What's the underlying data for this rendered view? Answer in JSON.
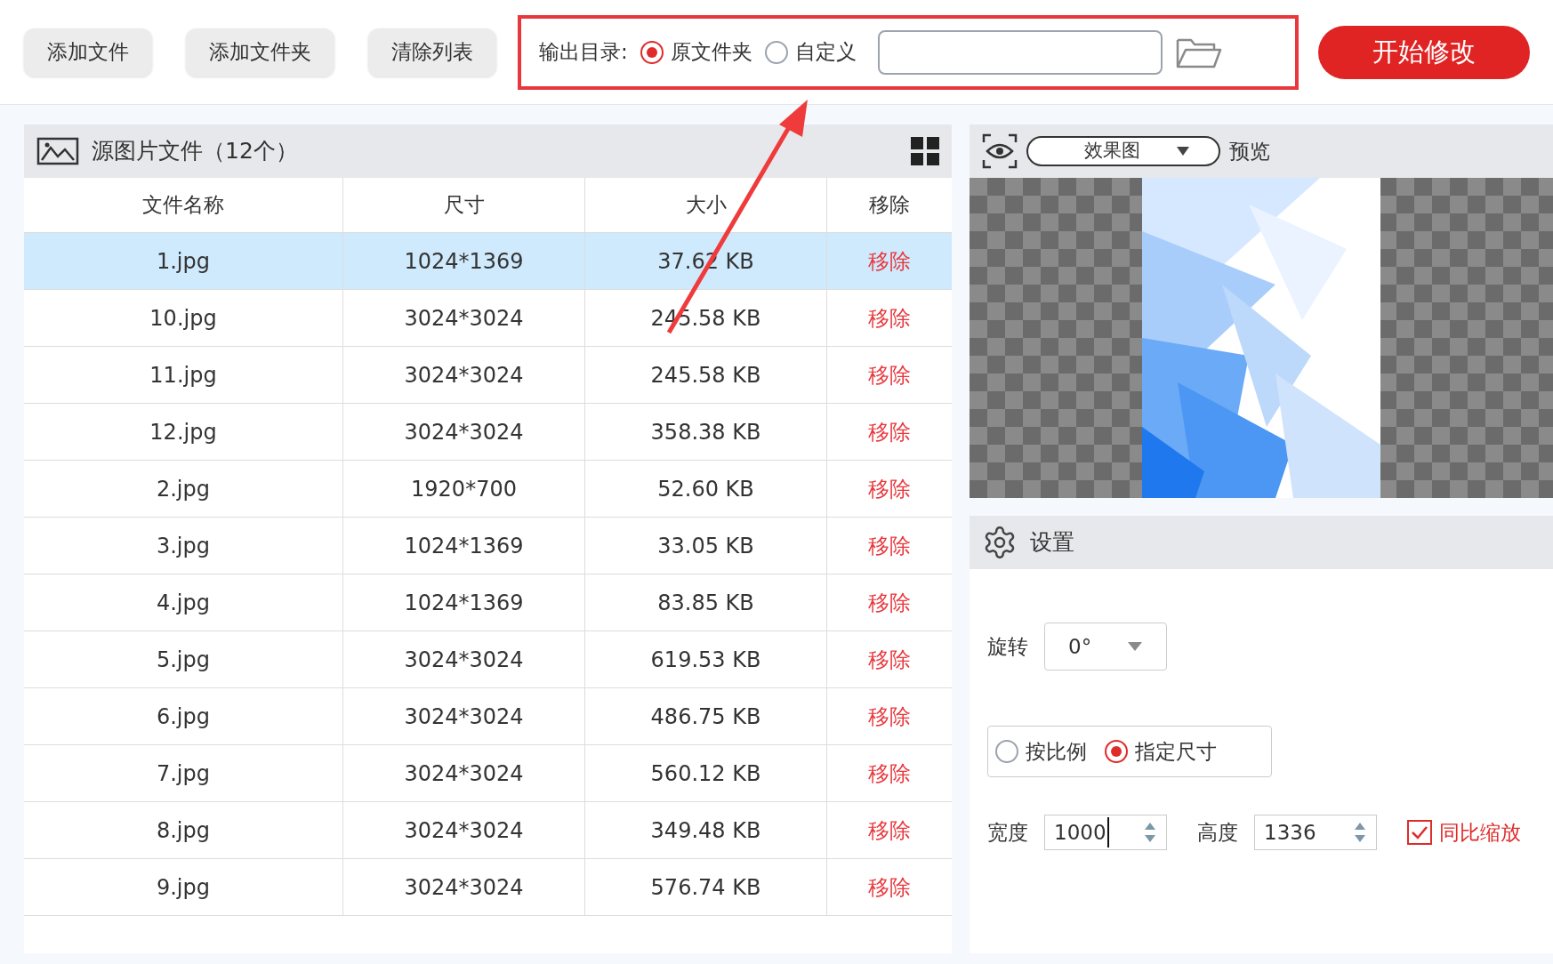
{
  "toolbar": {
    "buttons": [
      "添加文件",
      "添加文件夹",
      "清除列表"
    ],
    "output": {
      "label": "输出目录:",
      "options": [
        {
          "label": "原文件夹",
          "selected": true
        },
        {
          "label": "自定义",
          "selected": false
        }
      ]
    },
    "start_button": "开始修改"
  },
  "file_panel": {
    "title": "源图片文件（12个）",
    "columns": [
      "文件名称",
      "尺寸",
      "大小",
      "移除"
    ],
    "rows": [
      {
        "name": "1.jpg",
        "dimensions": "1024*1369",
        "size": "37.62 KB",
        "remove": "移除",
        "selected": true
      },
      {
        "name": "10.jpg",
        "dimensions": "3024*3024",
        "size": "245.58 KB",
        "remove": "移除",
        "selected": false
      },
      {
        "name": "11.jpg",
        "dimensions": "3024*3024",
        "size": "245.58 KB",
        "remove": "移除",
        "selected": false
      },
      {
        "name": "12.jpg",
        "dimensions": "3024*3024",
        "size": "358.38 KB",
        "remove": "移除",
        "selected": false
      },
      {
        "name": "2.jpg",
        "dimensions": "1920*700",
        "size": "52.60 KB",
        "remove": "移除",
        "selected": false
      },
      {
        "name": "3.jpg",
        "dimensions": "1024*1369",
        "size": "33.05 KB",
        "remove": "移除",
        "selected": false
      },
      {
        "name": "4.jpg",
        "dimensions": "1024*1369",
        "size": "83.85 KB",
        "remove": "移除",
        "selected": false
      },
      {
        "name": "5.jpg",
        "dimensions": "3024*3024",
        "size": "619.53 KB",
        "remove": "移除",
        "selected": false
      },
      {
        "name": "6.jpg",
        "dimensions": "3024*3024",
        "size": "486.75 KB",
        "remove": "移除",
        "selected": false
      },
      {
        "name": "7.jpg",
        "dimensions": "3024*3024",
        "size": "560.12 KB",
        "remove": "移除",
        "selected": false
      },
      {
        "name": "8.jpg",
        "dimensions": "3024*3024",
        "size": "349.48 KB",
        "remove": "移除",
        "selected": false
      },
      {
        "name": "9.jpg",
        "dimensions": "3024*3024",
        "size": "576.74 KB",
        "remove": "移除",
        "selected": false
      }
    ]
  },
  "preview": {
    "mode": "效果图",
    "label": "预览"
  },
  "settings": {
    "title": "设置",
    "rotation": {
      "label": "旋转",
      "value": "0°"
    },
    "scale_modes": [
      {
        "label": "按比例",
        "selected": false
      },
      {
        "label": "指定尺寸",
        "selected": true
      }
    ],
    "width": {
      "label": "宽度",
      "value": "1000"
    },
    "height": {
      "label": "高度",
      "value": "1336"
    },
    "keep_ratio": {
      "label": "同比缩放",
      "checked": true
    }
  }
}
